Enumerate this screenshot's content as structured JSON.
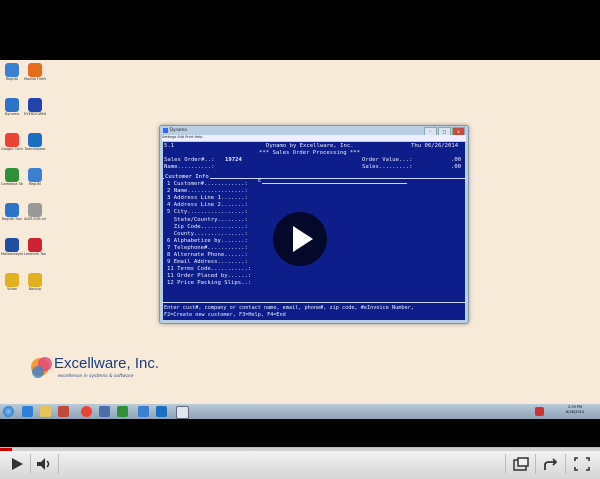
{
  "desktop": {
    "icons": [
      {
        "name": "RegUtil",
        "color": "#3a7fd0"
      },
      {
        "name": "Mozilla Firefox",
        "color": "#e76b1c"
      },
      {
        "name": "Dynamo",
        "color": "#2e73c8"
      },
      {
        "name": "EVERDOWNLOAD",
        "color": "#2244aa"
      },
      {
        "name": "Google Chrome",
        "color": "#e94335"
      },
      {
        "name": "TeamViewer",
        "color": "#1b6fc1"
      },
      {
        "name": "Camtasia Studio 8",
        "color": "#2f8f3a"
      },
      {
        "name": "RegUtil",
        "color": "#3a7fd0"
      },
      {
        "name": "RegUtil Run",
        "color": "#2e73c8"
      },
      {
        "name": "ADM.SOft.ini",
        "color": "#999999"
      },
      {
        "name": "Malwarebytes",
        "color": "#1f4f9e"
      },
      {
        "name": "Lexmark Tools",
        "color": "#cc2233"
      },
      {
        "name": "Video",
        "color": "#e0b020"
      },
      {
        "name": "Backup",
        "color": "#e0b020"
      }
    ]
  },
  "window": {
    "title": "Dynamo",
    "menu": "Settings Edit Print Help",
    "controls": {
      "minimize": "–",
      "maximize": "□",
      "close": "x"
    }
  },
  "console": {
    "version": "5.1",
    "date": "Thu 06/26/2014",
    "company": "Dynamo by Excellware, Inc.",
    "module": "*** Sales Order Processing ***",
    "sales_order_label": "Sales Order#..:",
    "sales_order_value": "19724",
    "order_value_label": "Order Value...:",
    "order_value": ".00",
    "name_label": "Name..........:",
    "sales_label": "Sales.........:",
    "sales_value": ".00",
    "section_title": "Customer Info",
    "input_value": "E",
    "fields": [
      "1 Customer#............:",
      "2 Name.................:",
      "3 Address Line 1.......:",
      "4 Address Line 2.......:",
      "5 City.................:",
      "  State/Country........:",
      "  Zip Code.............:",
      "  County...............:",
      "6 Alphabetize by.......:",
      "7 Telephone#...........:",
      "8 Alternate Phone......:",
      "9 Email Address........:",
      "11 Terms Code...........:",
      "11 Order Placed by......:",
      "12 Price Packing Slips..:"
    ],
    "help_line1": "Enter cust#, company or contact name, email, phone#, zip code, #eInvoice Number,",
    "help_line2": "F2=Create new customer, F3=Help, F4=End"
  },
  "logo": {
    "text": "Excellware, Inc.",
    "tagline": "excellence in systems & software"
  },
  "taskbar": {
    "time": "2:39 PM",
    "date": "6/26/2014"
  },
  "player": {
    "progress_fraction": 0.02,
    "accent": "#cc0000"
  }
}
